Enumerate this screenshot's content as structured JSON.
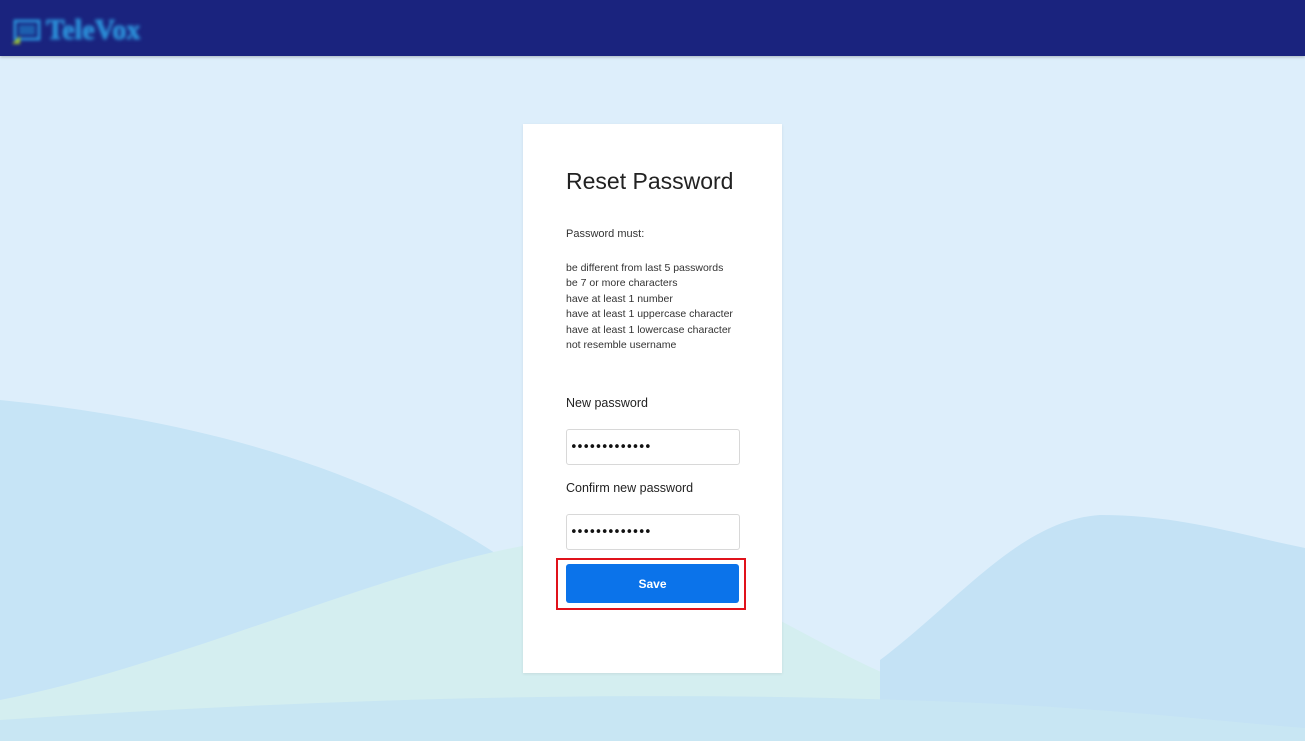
{
  "header": {
    "logo_text": "TeleVox",
    "background_color": "#1a237e"
  },
  "reset_form": {
    "title": "Reset Password",
    "rules_intro": "Password must:",
    "rules": [
      "be different from last 5 passwords",
      "be 7 or more characters",
      "have at least 1 number",
      "have at least 1 uppercase character",
      "have at least 1 lowercase character",
      "not resemble username"
    ],
    "new_password_label": "New password",
    "new_password_value": "•••••••••••••",
    "confirm_password_label": "Confirm new password",
    "confirm_password_value": "•••••••••••••",
    "save_label": "Save",
    "save_color": "#0b73ea",
    "highlight_color": "#e0121b"
  }
}
